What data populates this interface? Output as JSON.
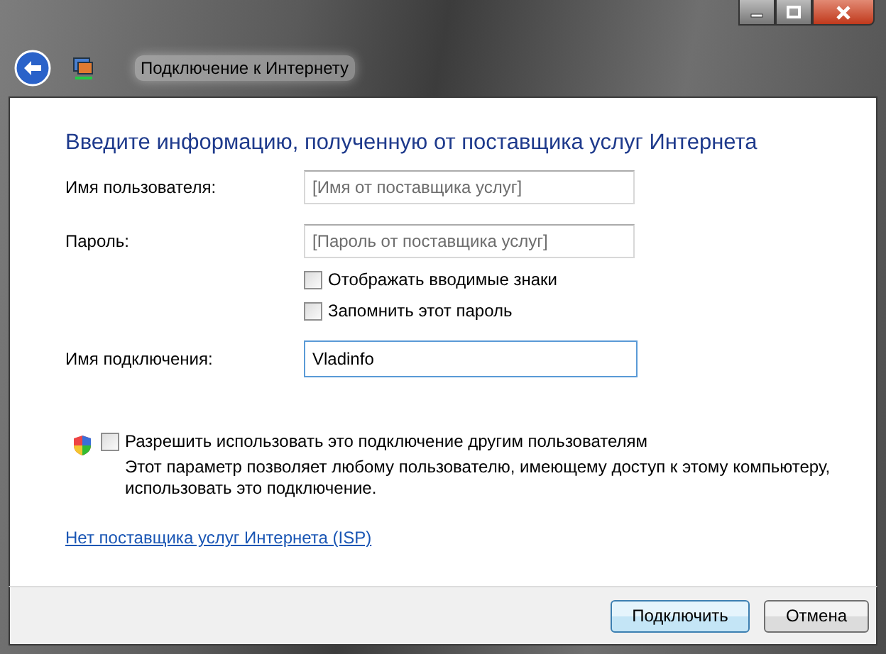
{
  "window": {
    "title": "Подключение к Интернету"
  },
  "heading": "Введите информацию, полученную от поставщика услуг Интернета",
  "fields": [
    {
      "label": "Имя пользователя:",
      "placeholder": "[Имя от поставщика услуг]",
      "focused": false
    },
    {
      "label": "Пароль:",
      "placeholder": "[Пароль от поставщика услуг]",
      "focused": false
    }
  ],
  "password_options": [
    {
      "label": "Отображать вводимые знаки",
      "checked": false
    },
    {
      "label": "Запомнить этот пароль",
      "checked": false
    }
  ],
  "connection_name": {
    "label": "Имя подключения:",
    "value": "Vladinfo",
    "focused": true
  },
  "share": {
    "label": "Разрешить использовать это подключение другим пользователям",
    "checked": false,
    "description": "Этот параметр позволяет любому пользователю, имеющему доступ к этому компьютеру, использовать это подключение."
  },
  "link": "Нет поставщика услуг Интернета (ISP)",
  "buttons": [
    {
      "label": "Подключить",
      "default": true
    },
    {
      "label": "Отмена",
      "default": false
    }
  ]
}
